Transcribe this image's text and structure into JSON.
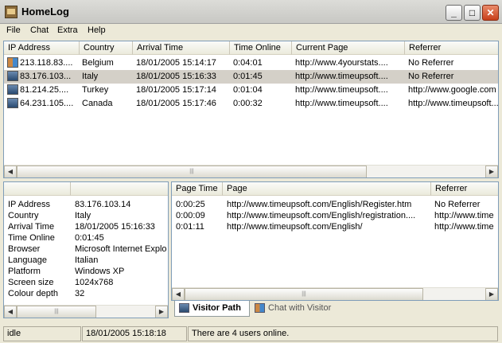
{
  "window": {
    "title": "HomeLog"
  },
  "title_buttons": {
    "minimize": "_",
    "maximize": "□",
    "close": "✕"
  },
  "menu": [
    "File",
    "Chat",
    "Extra",
    "Help"
  ],
  "visitors": {
    "columns": [
      "IP Address",
      "Country",
      "Arrival Time",
      "Time Online",
      "Current Page",
      "Referrer"
    ],
    "rows": [
      {
        "ip": "213.118.83....",
        "country": "Belgium",
        "arrival": "18/01/2005 15:14:17",
        "online": "0:04:01",
        "page": "http://www.4yourstats....",
        "referrer": "No Referrer",
        "icon": "user-icon",
        "selected": false
      },
      {
        "ip": "83.176.103...",
        "country": "Italy",
        "arrival": "18/01/2005 15:16:33",
        "online": "0:01:45",
        "page": "http://www.timeupsoft....",
        "referrer": "No Referrer",
        "icon": "monitor-icon",
        "selected": true
      },
      {
        "ip": "81.214.25....",
        "country": "Turkey",
        "arrival": "18/01/2005 15:17:14",
        "online": "0:01:04",
        "page": "http://www.timeupsoft....",
        "referrer": "http://www.google.com",
        "icon": "monitor-icon",
        "selected": false
      },
      {
        "ip": "64.231.105....",
        "country": "Canada",
        "arrival": "18/01/2005 15:17:46",
        "online": "0:00:32",
        "page": "http://www.timeupsoft....",
        "referrer": "http://www.timeupsoft....",
        "icon": "monitor-icon",
        "selected": false
      }
    ]
  },
  "details": {
    "rows": [
      {
        "label": "IP Address",
        "value": "83.176.103.14"
      },
      {
        "label": "Country",
        "value": "Italy"
      },
      {
        "label": "Arrival Time",
        "value": "18/01/2005 15:16:33"
      },
      {
        "label": "Time Online",
        "value": "0:01:45"
      },
      {
        "label": "Browser",
        "value": "Microsoft Internet Explo"
      },
      {
        "label": "Language",
        "value": "Italian"
      },
      {
        "label": "Platform",
        "value": "Windows XP"
      },
      {
        "label": "Screen size",
        "value": "1024x768"
      },
      {
        "label": "Colour depth",
        "value": "32"
      }
    ]
  },
  "path": {
    "columns": [
      "Page Time",
      "Page",
      "Referrer"
    ],
    "rows": [
      {
        "time": "0:00:25",
        "page": "http://www.timeupsoft.com/English/Register.htm",
        "referrer": "No Referrer"
      },
      {
        "time": "0:00:09",
        "page": "http://www.timeupsoft.com/English/registration....",
        "referrer": "http://www.time"
      },
      {
        "time": "0:01:11",
        "page": "http://www.timeupsoft.com/English/",
        "referrer": "http://www.time"
      }
    ]
  },
  "tabs": [
    {
      "label": "Visitor Path",
      "active": true,
      "icon": "monitor-icon"
    },
    {
      "label": "Chat with Visitor",
      "active": false,
      "icon": "chat-users-icon"
    }
  ],
  "status": {
    "state": "idle",
    "time": "18/01/2005 15:18:18",
    "message": "There are 4 users online."
  },
  "colors": {
    "selected_row": "#d4d0c8",
    "grid_border": "#7f9db9",
    "face": "#ece9d8"
  }
}
